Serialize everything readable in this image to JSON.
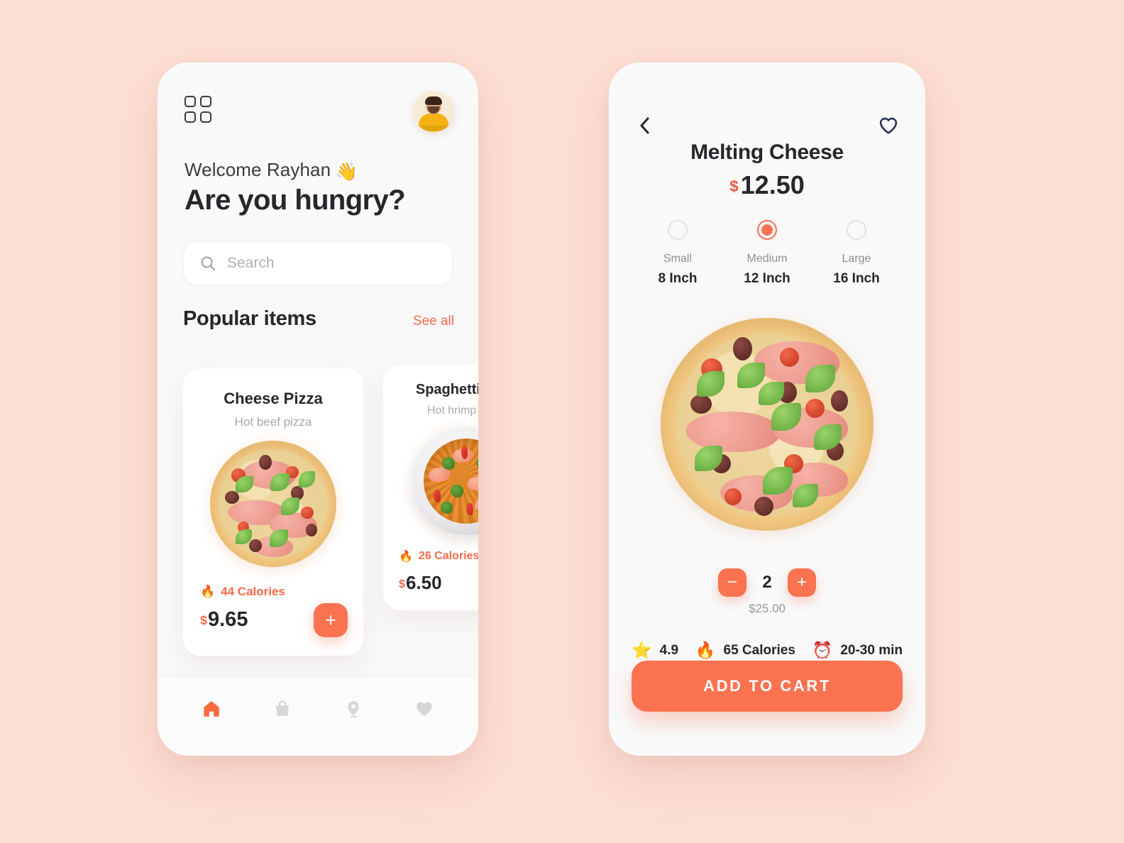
{
  "theme": {
    "background": "#FCDED4",
    "screen": "#F9F9FA",
    "accent": "#FA7250",
    "accent_text": "#F86B4A",
    "price_currency": "#F4553F",
    "dark_text": "#26262B",
    "muted_text": "#9A9A9E",
    "navy": "#2B3356"
  },
  "home": {
    "menu_icon": "grid-icon",
    "avatar_icon": "user-avatar",
    "greeting": "Welcome Rayhan",
    "greeting_emoji": "👋",
    "headline": "Are you hungry?",
    "search": {
      "icon": "search-icon",
      "placeholder": "Search",
      "value": ""
    },
    "section": {
      "title": "Popular items",
      "see_all": "See all"
    },
    "items": [
      {
        "name": "Cheese Pizza",
        "subtitle": "Hot beef pizza",
        "calories": "44 Calories",
        "calories_emoji": "🔥",
        "currency": "$",
        "price": "9.65",
        "add_label": "+",
        "image": "pizza-photo"
      },
      {
        "name": "Spaghetti Orzo",
        "subtitle": "Hot hrimp spicy",
        "calories": "26 Calories",
        "calories_emoji": "🔥",
        "currency": "$",
        "price": "6.50",
        "add_label": "+",
        "image": "spaghetti-photo"
      }
    ],
    "nav": [
      {
        "icon": "home-icon",
        "active": true
      },
      {
        "icon": "bag-icon",
        "active": false
      },
      {
        "icon": "location-pin-icon",
        "active": false
      },
      {
        "icon": "heart-icon",
        "active": false
      }
    ]
  },
  "detail": {
    "back_icon": "chevron-left-icon",
    "favorite_icon": "heart-outline-icon",
    "title": "Melting Cheese",
    "currency": "$",
    "price": "12.50",
    "sizes": [
      {
        "label": "Small",
        "dimension": "8 Inch",
        "selected": false
      },
      {
        "label": "Medium",
        "dimension": "12 Inch",
        "selected": true
      },
      {
        "label": "Large",
        "dimension": "16 Inch",
        "selected": false
      }
    ],
    "hero_image": "pizza-photo",
    "quantity": {
      "decrease_label": "−",
      "value": "2",
      "increase_label": "+",
      "total": "$25.00"
    },
    "stats": [
      {
        "emoji": "⭐",
        "label": "4.9",
        "icon": "star-icon"
      },
      {
        "emoji": "🔥",
        "label": "65 Calories",
        "icon": "fire-icon"
      },
      {
        "emoji": "⏰",
        "label": "20-30 min",
        "icon": "clock-icon"
      }
    ],
    "cta_label": "ADD TO CART"
  }
}
